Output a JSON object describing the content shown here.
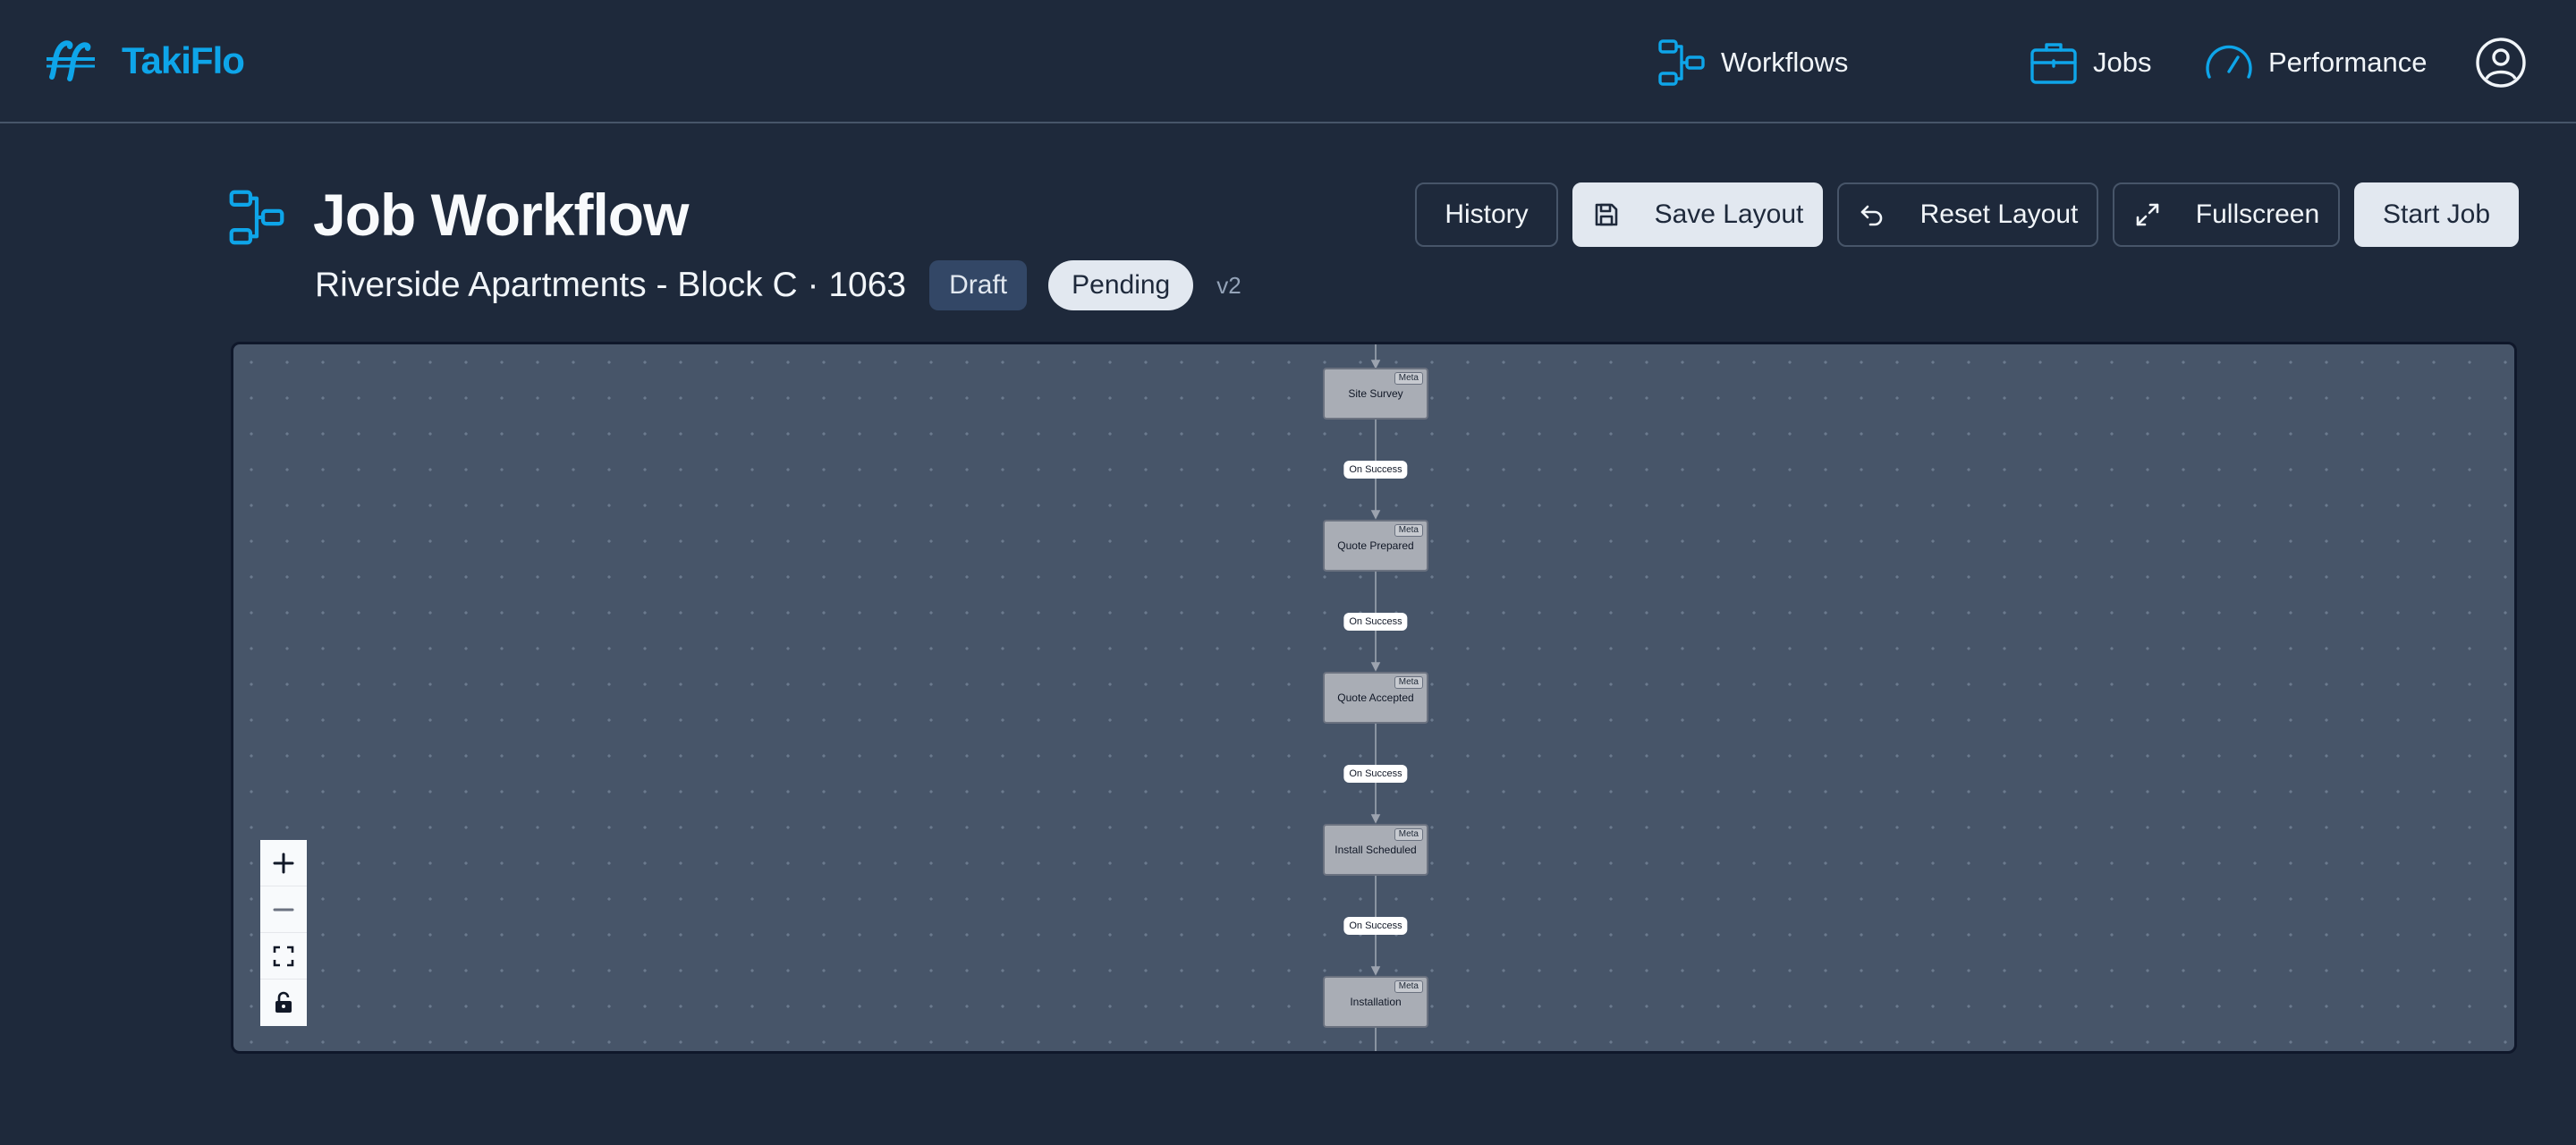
{
  "app": {
    "name": "TakiFlo",
    "logo_icon": "takiflo-logo",
    "accent": "#0ea5e9"
  },
  "nav": {
    "workflows": {
      "label": "Workflows",
      "icon": "workflow-icon"
    },
    "jobs": {
      "label": "Jobs",
      "icon": "briefcase-icon"
    },
    "performance": {
      "label": "Performance",
      "icon": "gauge-icon"
    },
    "user_icon": "user-circle-icon"
  },
  "header": {
    "title": "Job Workflow",
    "job_name": "Riverside Apartments - Block C · 1063",
    "status_badge": "Draft",
    "state_badge": "Pending",
    "version": "v2"
  },
  "actions": {
    "history": "History",
    "save_layout": "Save Layout",
    "reset_layout": "Reset Layout",
    "fullscreen": "Fullscreen",
    "start_job": "Start Job"
  },
  "workflow": {
    "nodes": [
      {
        "label": "Site Survey",
        "tag": "Meta"
      },
      {
        "label": "Quote Prepared",
        "tag": "Meta"
      },
      {
        "label": "Quote Accepted",
        "tag": "Meta"
      },
      {
        "label": "Install Scheduled",
        "tag": "Meta"
      },
      {
        "label": "Installation",
        "tag": "Meta"
      }
    ],
    "edges": [
      {
        "label": "On Success"
      },
      {
        "label": "On Success"
      },
      {
        "label": "On Success"
      },
      {
        "label": "On Success"
      }
    ]
  },
  "canvas_controls": [
    "zoom-in",
    "zoom-out",
    "fit-view",
    "lock"
  ]
}
